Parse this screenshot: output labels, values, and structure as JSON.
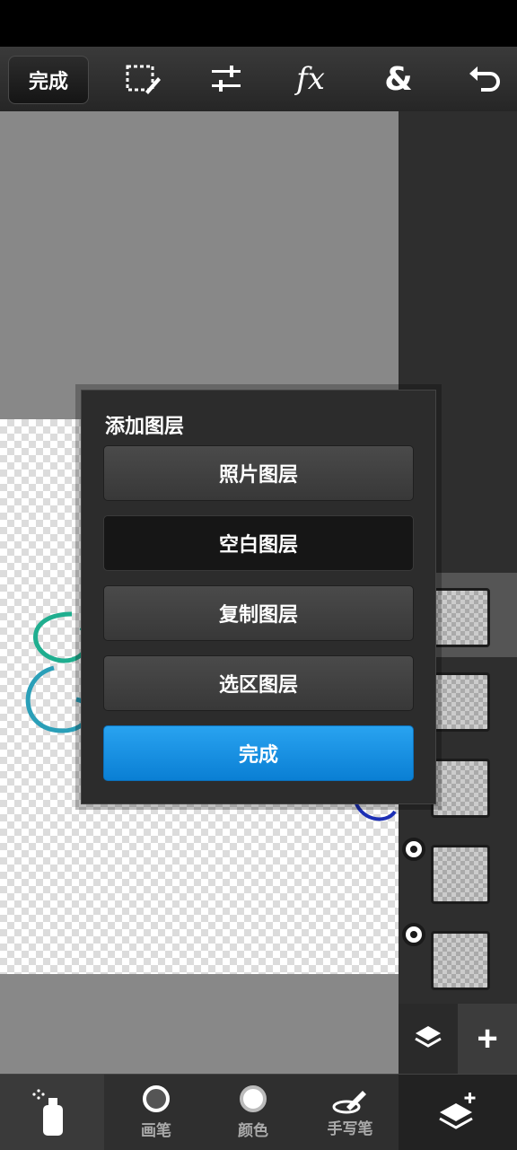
{
  "toolbar": {
    "done_label": "完成",
    "icons": [
      "selection-edit-icon",
      "adjust-sliders-icon",
      "fx-icon",
      "ampersand-icon",
      "undo-icon"
    ],
    "fx_label": "fx",
    "amp_label": "&"
  },
  "dialog": {
    "title": "添加图层",
    "options": [
      {
        "label": "照片图层",
        "state": "normal"
      },
      {
        "label": "空白图层",
        "state": "selected"
      },
      {
        "label": "复制图层",
        "state": "normal"
      },
      {
        "label": "选区图层",
        "state": "normal"
      }
    ],
    "confirm_label": "完成"
  },
  "layers": {
    "count": 5,
    "add_label": "+"
  },
  "bottombar": {
    "brush_label": "画笔",
    "color_label": "颜色",
    "handwriting_label": "手写笔"
  },
  "colors": {
    "accent": "#1a90e0",
    "canvas_bg": "#888888"
  }
}
